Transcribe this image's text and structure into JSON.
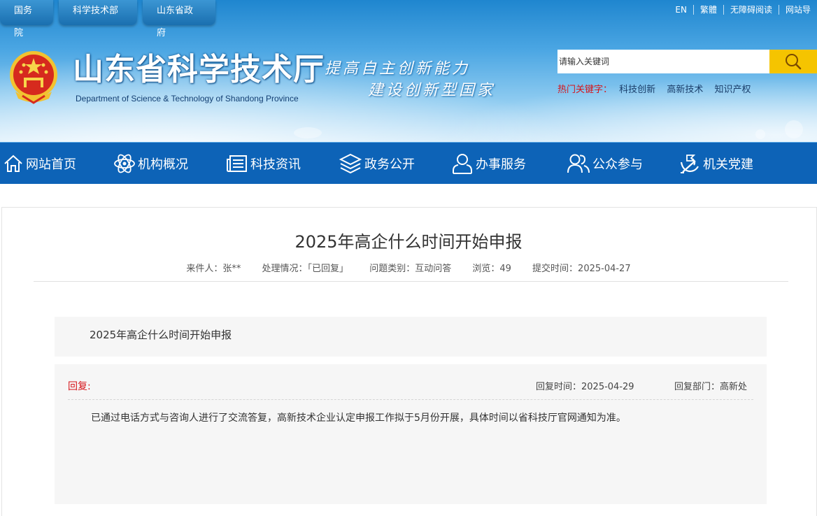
{
  "header": {
    "top_links": [
      "国务院",
      "科学技术部",
      "山东省政府"
    ],
    "utils": [
      "EN",
      "繁體",
      "无障碍阅读",
      "网站导"
    ],
    "site_title": "山东省科学技术厅",
    "site_subtitle": "Department of Science & Technology of Shandong Province",
    "slogan_line1": "提高自主创新能力",
    "slogan_line2": "建设创新型国家",
    "search": {
      "placeholder": "请输入关键词",
      "button_icon": "search-icon"
    },
    "hot_label": "热门关键字：",
    "hot_words": [
      "科技创新",
      "高新技术",
      "知识产权"
    ]
  },
  "nav": {
    "items": [
      {
        "label": "网站首页",
        "icon": "home-icon"
      },
      {
        "label": "机构概况",
        "icon": "atom-icon"
      },
      {
        "label": "科技资讯",
        "icon": "news-icon"
      },
      {
        "label": "政务公开",
        "icon": "layers-icon"
      },
      {
        "label": "办事服务",
        "icon": "user-icon"
      },
      {
        "label": "公众参与",
        "icon": "users-icon"
      },
      {
        "label": "机关党建",
        "icon": "party-icon"
      }
    ]
  },
  "question": {
    "title": "2025年高企什么时间开始申报",
    "meta": {
      "sender": "来件人：张**",
      "status": "处理情况：「已回复」",
      "category": "问题类别：互动问答",
      "views": "浏览：49",
      "submitted": "提交时间：2025-04-27"
    },
    "body": "2025年高企什么时间开始申报"
  },
  "reply": {
    "label": "回复:",
    "time": "回复时间：2025-04-29",
    "department": "回复部门：高新处",
    "text": "已通过电话方式与咨询人进行了交流答复，高新技术企业认定申报工作拟于5月份开展，具体时间以省科技厅官网通知为准。"
  },
  "colors": {
    "nav_bg": "#0d63b7",
    "accent_red": "#d6141a",
    "search_button": "#f5c400"
  }
}
